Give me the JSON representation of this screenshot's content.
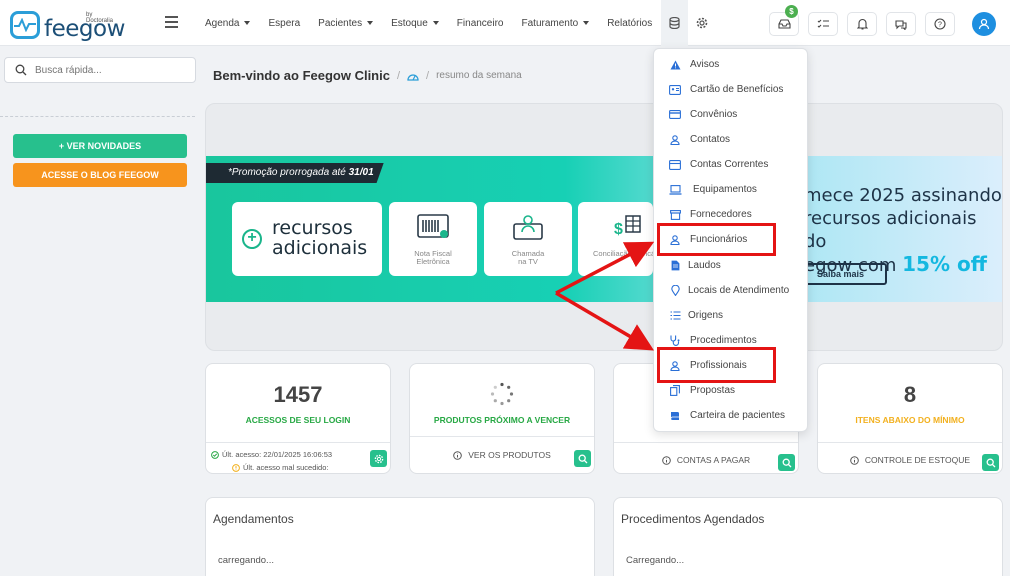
{
  "app": {
    "logo_text": "feegow",
    "logo_by": "by Doctoralia"
  },
  "nav": {
    "items": [
      {
        "label": "Agenda",
        "caret": true
      },
      {
        "label": "Espera",
        "caret": false
      },
      {
        "label": "Pacientes",
        "caret": true
      },
      {
        "label": "Estoque",
        "caret": true
      },
      {
        "label": "Financeiro",
        "caret": false
      },
      {
        "label": "Faturamento",
        "caret": true
      },
      {
        "label": "Relatórios",
        "caret": false
      }
    ],
    "icons": [
      "database-icon",
      "gear-icon"
    ],
    "right_icons": [
      "inbox-icon",
      "checklist-icon",
      "bell-icon",
      "chat-icon",
      "help-icon"
    ],
    "badge": "$"
  },
  "sidebar": {
    "search_placeholder": "Busca rápida...",
    "btn_news": "+ VER NOVIDADES",
    "btn_blog": "ACESSE O BLOG FEEGOW"
  },
  "breadcrumb": {
    "title": "Bem-vindo ao Feegow Clinic",
    "sep": "/",
    "sub": "resumo da semana"
  },
  "banner": {
    "promo_text": "*Promoção prorrogada até ",
    "promo_date": "31/01",
    "big_tile": "recursos adicionais",
    "tiles": [
      "Nota Fiscal Eletrônica",
      "Chamada na TV",
      "Conciliação Bancária"
    ],
    "right_line1": "mece 2025 assinando",
    "right_line2": "recursos adicionais do",
    "right_line3": "egow com ",
    "right_highlight": "15% off",
    "cta": "Saiba mais"
  },
  "cards": [
    {
      "value": "1457",
      "label": "ACESSOS DE SEU LOGIN",
      "foot1": "Últ. acesso: 22/01/2025 16:06:53",
      "foot2": "Últ. acesso mal sucedido:",
      "color": "#27a844"
    },
    {
      "value": "",
      "label": "PRODUTOS PRÓXIMO A VENCER",
      "link": "VER OS PRODUTOS",
      "color": "#27a844"
    },
    {
      "value": "",
      "label": "",
      "link": "CONTAS A PAGAR",
      "color": "#27a844"
    },
    {
      "value": "8",
      "label": "ITENS ABAIXO DO MÍNIMO",
      "link": "CONTROLE DE ESTOQUE",
      "color": "#f2b01e"
    }
  ],
  "panels": [
    {
      "title": "Agendamentos",
      "status": "carregando..."
    },
    {
      "title": "Procedimentos Agendados",
      "status": "Carregando..."
    }
  ],
  "dropdown": {
    "items": [
      {
        "label": "Avisos",
        "icon": "warning-icon"
      },
      {
        "label": "Cartão de Benefícios",
        "icon": "id-card-icon"
      },
      {
        "label": "Convênios",
        "icon": "credit-card-icon"
      },
      {
        "label": "Contatos",
        "icon": "user-icon"
      },
      {
        "label": "Contas Correntes",
        "icon": "bank-icon"
      },
      {
        "label": "Equipamentos",
        "icon": "laptop-icon"
      },
      {
        "label": "Fornecedores",
        "icon": "box-icon"
      },
      {
        "label": "Funcionários",
        "icon": "user-icon"
      },
      {
        "label": "Laudos",
        "icon": "file-icon"
      },
      {
        "label": "Locais de Atendimento",
        "icon": "map-pin-icon"
      },
      {
        "label": "Origens",
        "icon": "list-icon"
      },
      {
        "label": "Procedimentos",
        "icon": "stethoscope-icon"
      },
      {
        "label": "Profissionais",
        "icon": "user-icon"
      },
      {
        "label": "Propostas",
        "icon": "copy-icon"
      },
      {
        "label": "Carteira de pacientes",
        "icon": "book-icon"
      }
    ]
  },
  "colors": {
    "accent": "#1e8fe0",
    "green": "#27c08d",
    "orange": "#f7941d",
    "highlight": "#e41414"
  }
}
